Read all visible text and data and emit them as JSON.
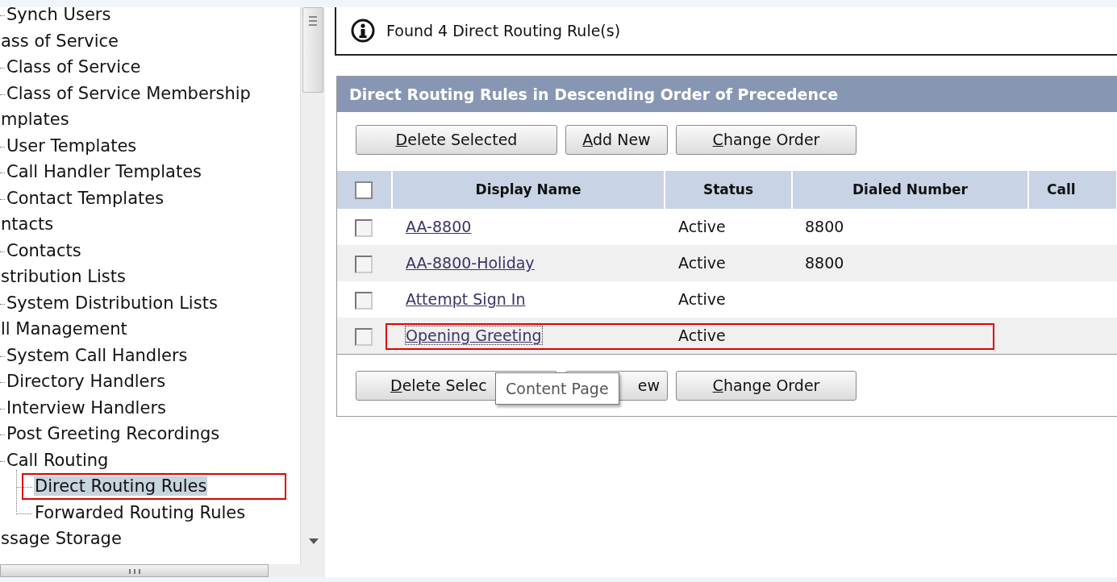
{
  "sidebar": {
    "tree": [
      {
        "children": [
          {
            "label": "Synch Users",
            "selected": false,
            "annotated": false
          }
        ]
      },
      {
        "label": "ass of Service",
        "selected": false,
        "annotated": false,
        "children": [
          {
            "label": "Class of Service",
            "selected": false,
            "annotated": false
          },
          {
            "label": "Class of Service Membership",
            "selected": false,
            "annotated": false
          }
        ]
      },
      {
        "label": "mplates",
        "selected": false,
        "annotated": false,
        "children": [
          {
            "label": "User Templates",
            "selected": false,
            "annotated": false
          },
          {
            "label": "Call Handler Templates",
            "selected": false,
            "annotated": false
          },
          {
            "label": "Contact Templates",
            "selected": false,
            "annotated": false
          }
        ]
      },
      {
        "label": "ntacts",
        "selected": false,
        "annotated": false,
        "children": [
          {
            "label": "Contacts",
            "selected": false,
            "annotated": false
          }
        ]
      },
      {
        "label": "stribution Lists",
        "selected": false,
        "annotated": false,
        "children": [
          {
            "label": "System Distribution Lists",
            "selected": false,
            "annotated": false
          }
        ]
      },
      {
        "label": "ll Management",
        "selected": false,
        "annotated": false,
        "children": [
          {
            "label": "System Call Handlers",
            "selected": false,
            "annotated": false
          },
          {
            "label": "Directory Handlers",
            "selected": false,
            "annotated": false
          },
          {
            "label": "Interview Handlers",
            "selected": false,
            "annotated": false
          },
          {
            "label": "Post Greeting Recordings",
            "selected": false,
            "annotated": false
          },
          {
            "label": "Call Routing",
            "selected": false,
            "annotated": false,
            "children": [
              {
                "label": "Direct Routing Rules",
                "selected": true,
                "annotated": true
              },
              {
                "label": "Forwarded Routing Rules",
                "selected": false,
                "annotated": false
              }
            ]
          }
        ]
      },
      {
        "label": "ssage Storage",
        "selected": false,
        "annotated": false
      }
    ]
  },
  "message": {
    "text": "Found 4 Direct Routing Rule(s)"
  },
  "panel": {
    "title": "Direct Routing Rules in Descending Order of Precedence",
    "top_buttons": [
      {
        "label": "Delete Selected",
        "mnemonic": true
      },
      {
        "label": "Add New",
        "mnemonic": true
      },
      {
        "label": "Change Order",
        "mnemonic": true
      }
    ],
    "table": {
      "select_all": {
        "checked": false
      },
      "columns": [
        "Display Name",
        "Status",
        "Dialed Number",
        "Call"
      ],
      "rows": [
        {
          "checked": false,
          "annotated": false,
          "focused": false,
          "name": "AA-8800",
          "status": "Active",
          "dialed_number": "8800"
        },
        {
          "checked": false,
          "annotated": false,
          "focused": false,
          "name": "AA-8800-Holiday",
          "status": "Active",
          "dialed_number": "8800"
        },
        {
          "checked": false,
          "annotated": false,
          "focused": false,
          "name": "Attempt Sign In",
          "status": "Active"
        },
        {
          "checked": false,
          "annotated": true,
          "focused": true,
          "name": "Opening Greeting",
          "status": "Active"
        }
      ]
    },
    "bottom_buttons": [
      {
        "label": "Delete Selec",
        "mnemonic": true
      },
      {
        "label": "ew",
        "mnemonic": false
      },
      {
        "label": "Change Order",
        "mnemonic": true
      }
    ],
    "tooltip": {
      "text": "Content Page"
    }
  }
}
